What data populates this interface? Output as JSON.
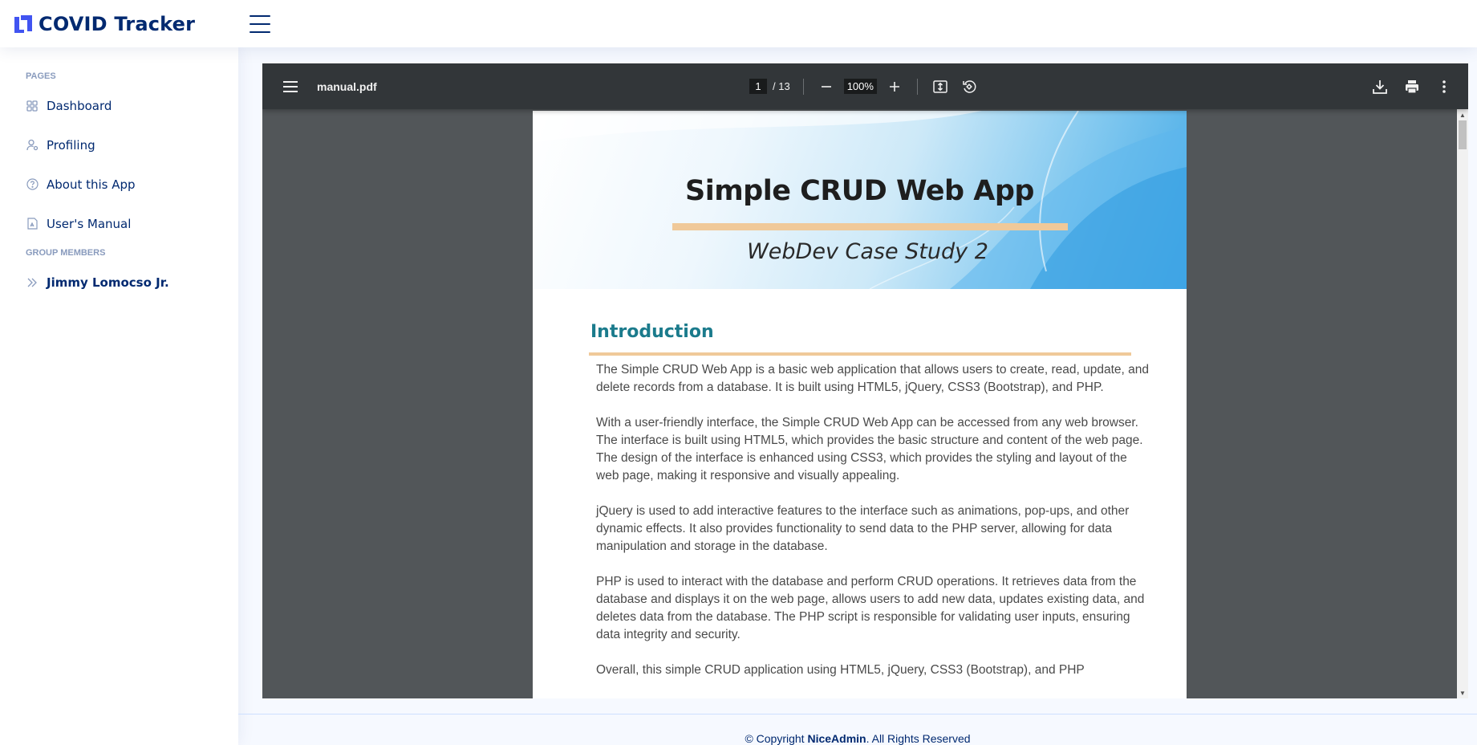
{
  "app": {
    "title": "COVID Tracker",
    "accent_color": "#4154f1",
    "logo_icon": "logo-mark-icon",
    "menu_icon": "hamburger-menu-icon"
  },
  "sidebar": {
    "pages_heading": "PAGES",
    "items": [
      {
        "label": "Dashboard",
        "icon": "grid-icon"
      },
      {
        "label": "Profiling",
        "icon": "person-gear-icon"
      },
      {
        "label": "About this App",
        "icon": "question-circle-icon"
      },
      {
        "label": "User's Manual",
        "icon": "file-pdf-icon"
      }
    ],
    "members_heading": "GROUP MEMBERS",
    "members": [
      {
        "label": "Jimmy Lomocso Jr.",
        "icon": "chevron-double-right-icon"
      }
    ]
  },
  "pdf_viewer": {
    "file_name": "manual.pdf",
    "current_page": "1",
    "total_pages": "/ 13",
    "zoom": "100%",
    "toolbar_icons": [
      "menu-icon",
      "zoom-out-icon",
      "zoom-in-icon",
      "fit-page-icon",
      "rotate-icon",
      "download-icon",
      "print-icon",
      "more-options-icon"
    ],
    "document": {
      "title": "Simple CRUD Web App",
      "subtitle": "WebDev Case Study 2",
      "section_heading": "Introduction",
      "paragraphs": [
        "The Simple CRUD Web App is a basic web application that allows users to create, read, update, and delete records from a database. It is built using HTML5, jQuery, CSS3 (Bootstrap), and PHP.",
        "With a user-friendly interface, the Simple CRUD Web App can be accessed from any web browser. The interface is built using HTML5, which provides the basic structure and content of the web page. The design of the interface is enhanced using CSS3, which provides the styling and layout of the web page, making it responsive and visually appealing.",
        "jQuery is used to add interactive features to the interface such as animations, pop-ups, and other dynamic effects. It also provides functionality to send data to the PHP server, allowing for data manipulation and storage in the database.",
        "PHP is used to interact with the database and perform CRUD operations. It retrieves data from the database and displays it on the web page, allows users to add new data, updates existing data, and deletes data from the database. The PHP script is responsible for validating user inputs, ensuring data integrity and security.",
        "Overall, this simple CRUD application using HTML5, jQuery, CSS3 (Bootstrap), and PHP"
      ]
    }
  },
  "footer": {
    "prefix": "© Copyright ",
    "brand": "NiceAdmin",
    "suffix": ". All Rights Reserved"
  }
}
